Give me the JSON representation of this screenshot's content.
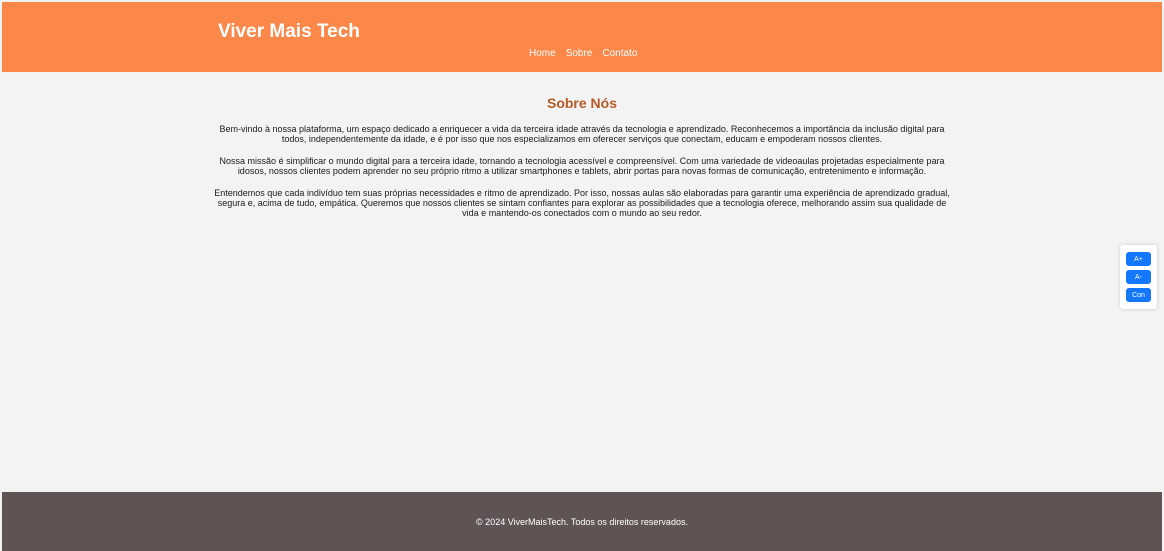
{
  "header": {
    "brand": "Viver Mais Tech",
    "nav": [
      {
        "label": "Home"
      },
      {
        "label": "Sobre"
      },
      {
        "label": "Contato"
      }
    ]
  },
  "main": {
    "title": "Sobre Nós",
    "paragraphs": [
      "Bem-vindo à nossa plataforma, um espaço dedicado a enriquecer a vida da terceira idade através da tecnologia e aprendizado. Reconhecemos a importância da inclusão digital para todos, independentemente da idade, e é por isso que nos especializamos em oferecer serviços que conectam, educam e empoderam nossos clientes.",
      "Nossa missão é simplificar o mundo digital para a terceira idade, tornando a tecnologia acessível e compreensível. Com uma variedade de videoaulas projetadas especialmente para idosos, nossos clientes podem aprender no seu próprio ritmo a utilizar smartphones e tablets, abrir portas para novas formas de comunicação, entretenimento e informação.",
      "Entendemos que cada indivíduo tem suas próprias necessidades e ritmo de aprendizado. Por isso, nossas aulas são elaboradas para garantir uma experiência de aprendizado gradual, segura e, acima de tudo, empática. Queremos que nossos clientes se sintam confiantes para explorar as possibilidades que a tecnologia oferece, melhorando assim sua qualidade de vida e mantendo-os conectados com o mundo ao seu redor."
    ]
  },
  "accessibility": {
    "increase": "A+",
    "decrease": "A-",
    "contrast": "Con"
  },
  "footer": {
    "text": "© 2024 ViverMaisTech. Todos os direitos reservados."
  },
  "colors": {
    "header_bg": "#fb8748",
    "title": "#b65a24",
    "button": "#1378ff",
    "footer_bg": "#605354"
  }
}
